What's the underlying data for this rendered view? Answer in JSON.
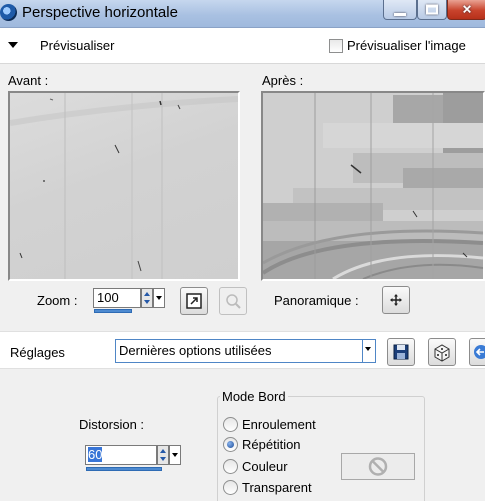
{
  "window": {
    "title": "Perspective horizontale"
  },
  "preview": {
    "toggle_label": "Prévisualiser",
    "image_preview_label": "Prévisualiser l'image",
    "before_label": "Avant :",
    "after_label": "Après :"
  },
  "zoom": {
    "label": "Zoom :",
    "value": "100",
    "pan_label": "Panoramique :"
  },
  "presets": {
    "label": "Réglages",
    "selected": "Dernières options utilisées"
  },
  "distortion": {
    "label": "Distorsion :",
    "value": "60"
  },
  "edge_mode": {
    "title": "Mode Bord",
    "options": [
      "Enroulement",
      "Répétition",
      "Couleur",
      "Transparent"
    ],
    "selected": "Répétition"
  }
}
